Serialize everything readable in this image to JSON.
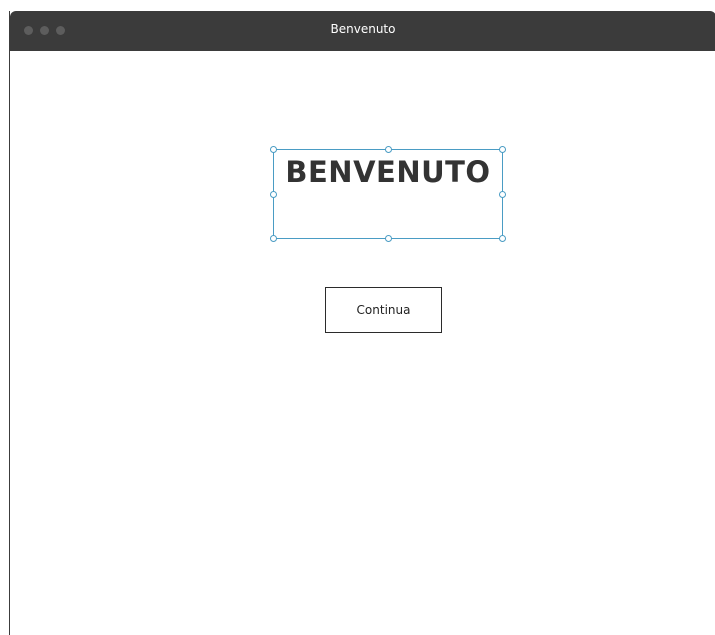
{
  "window": {
    "title": "Benvenuto"
  },
  "main": {
    "heading": "BENVENUTO",
    "continue_label": "Continua"
  },
  "icons": {
    "traffic_lights": [
      "close-icon",
      "minimize-icon",
      "maximize-icon"
    ],
    "selection_handles": "resize-handle-icon"
  },
  "colors": {
    "titlebar": "#3b3b3b",
    "selection": "#4a9cc4",
    "heading_text": "#333333"
  }
}
